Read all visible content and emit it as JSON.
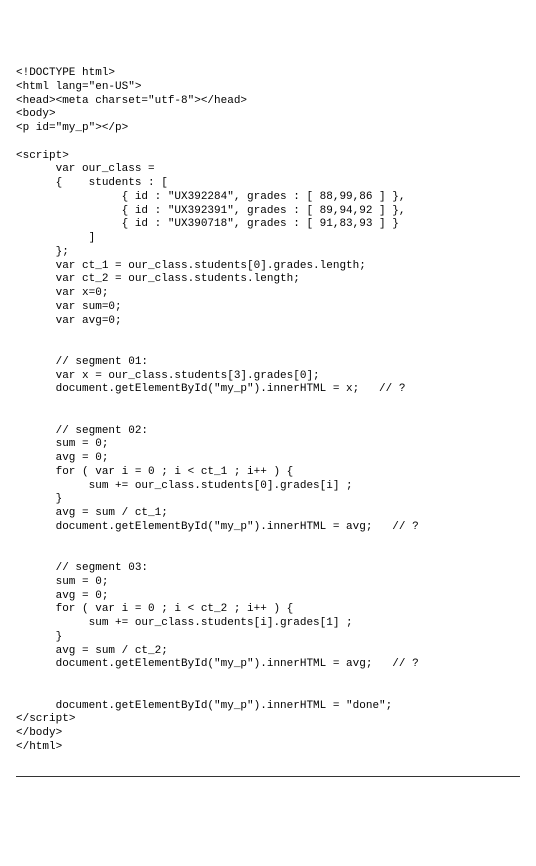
{
  "code": "<!DOCTYPE html>\n<html lang=\"en-US\">\n<head><meta charset=\"utf-8\"></head>\n<body>\n<p id=\"my_p\"></p>\n\n<script>\n      var our_class =\n      {    students : [\n                { id : \"UX392284\", grades : [ 88,99,86 ] },\n                { id : \"UX392391\", grades : [ 89,94,92 ] },\n                { id : \"UX390718\", grades : [ 91,83,93 ] }\n           ]\n      };\n      var ct_1 = our_class.students[0].grades.length;\n      var ct_2 = our_class.students.length;\n      var x=0;\n      var sum=0;\n      var avg=0;\n\n\n      // segment 01:\n      var x = our_class.students[3].grades[0];\n      document.getElementById(\"my_p\").innerHTML = x;   // ?\n\n\n      // segment 02:\n      sum = 0;\n      avg = 0;\n      for ( var i = 0 ; i < ct_1 ; i++ ) {\n           sum += our_class.students[0].grades[i] ;\n      }\n      avg = sum / ct_1;\n      document.getElementById(\"my_p\").innerHTML = avg;   // ?\n\n\n      // segment 03:\n      sum = 0;\n      avg = 0;\n      for ( var i = 0 ; i < ct_2 ; i++ ) {\n           sum += our_class.students[i].grades[1] ;\n      }\n      avg = sum / ct_2;\n      document.getElementById(\"my_p\").innerHTML = avg;   // ?\n\n\n      document.getElementById(\"my_p\").innerHTML = \"done\";\n</scr",
  "code_tail": "ipt>\n</body>\n</html>"
}
